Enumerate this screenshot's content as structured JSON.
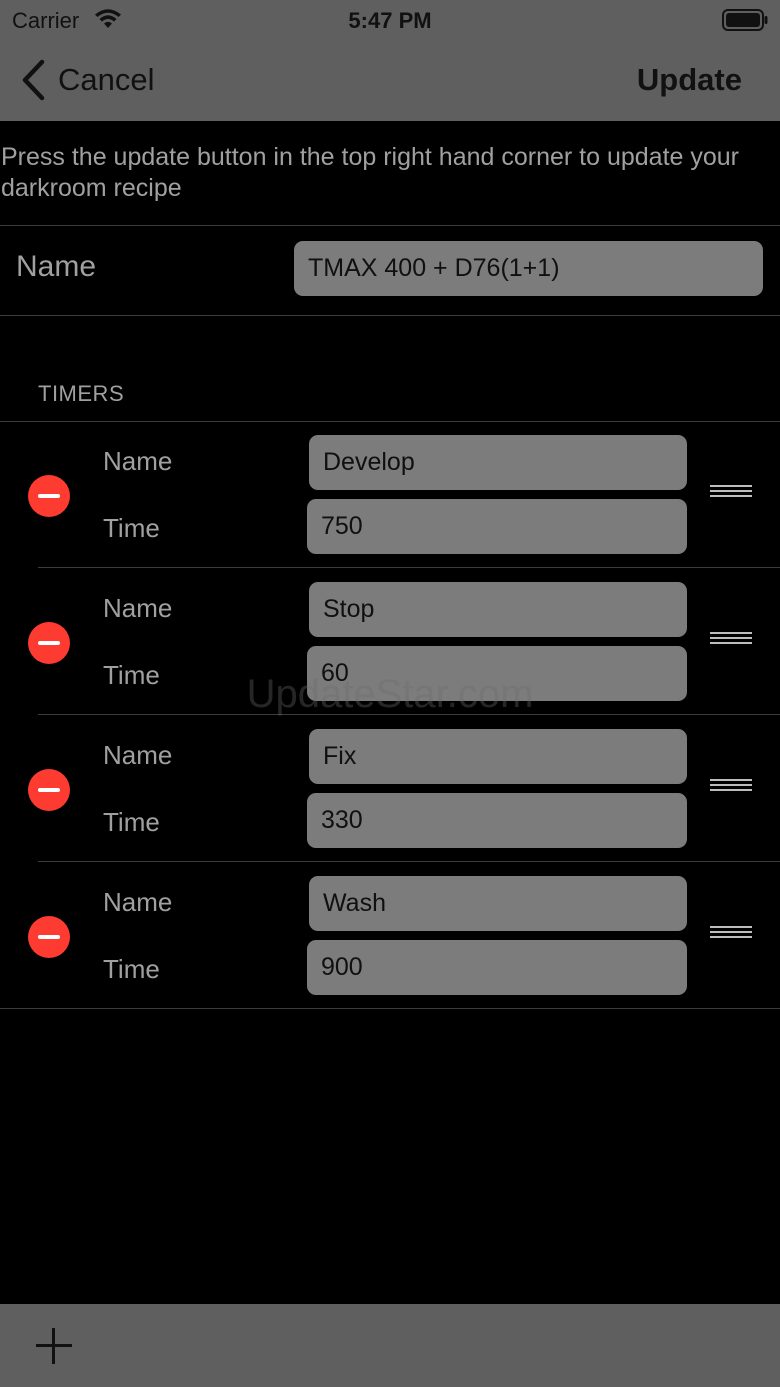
{
  "status_bar": {
    "carrier": "Carrier",
    "time": "5:47 PM",
    "wifi_icon": "wifi-icon",
    "battery_icon": "battery-icon"
  },
  "nav": {
    "back_label": "Cancel",
    "back_icon": "chevron-left-icon",
    "update_label": "Update"
  },
  "instructions": "Press the update button in the top right hand corner to update your darkroom recipe",
  "recipe": {
    "name_label": "Name",
    "name_value": "TMAX 400 + D76(1+1)"
  },
  "timers_section": {
    "header": "TIMERS",
    "name_label": "Name",
    "time_label": "Time",
    "items": [
      {
        "name": "Develop",
        "time": "750"
      },
      {
        "name": "Stop",
        "time": "60"
      },
      {
        "name": "Fix",
        "time": "330"
      },
      {
        "name": "Wash",
        "time": "900"
      }
    ]
  },
  "watermark": "UpdateStar.com",
  "toolbar": {
    "add_icon": "plus-icon"
  },
  "colors": {
    "bars": "#5f5f5f",
    "background": "#000000",
    "field": "#7c7c7c",
    "delete": "#fe3b30"
  }
}
